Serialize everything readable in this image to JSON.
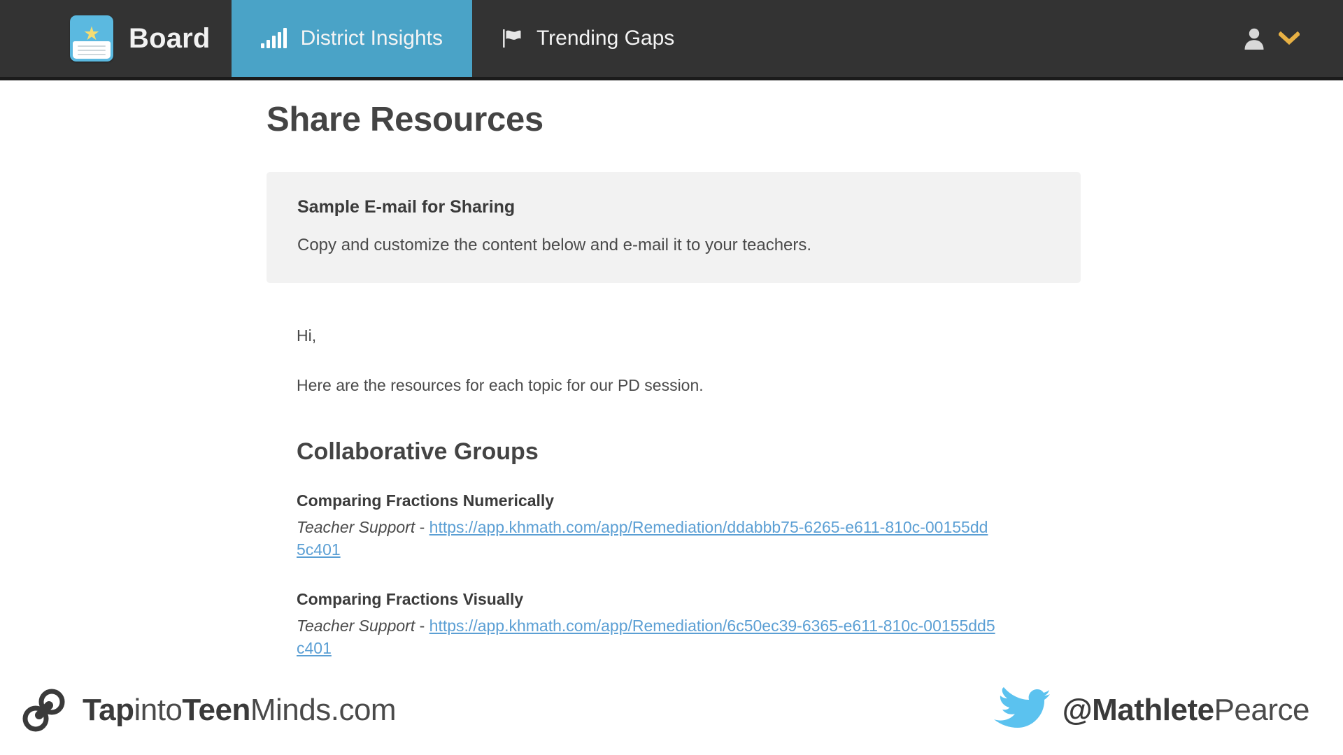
{
  "navbar": {
    "brand": {
      "label": "Board",
      "logo_icon": "book-star-icon",
      "star_glyph": "★"
    },
    "tabs": [
      {
        "label": "District Insights",
        "icon": "bar-chart-icon",
        "active": true
      },
      {
        "label": "Trending Gaps",
        "icon": "flag-icon",
        "active": false
      }
    ],
    "user_menu": {
      "avatar_icon": "user-icon",
      "chevron_icon": "chevron-down-icon"
    },
    "colors": {
      "background": "#333333",
      "active_tab": "#4aa3c7",
      "chevron": "#e8b144"
    }
  },
  "page": {
    "title": "Share Resources",
    "alert": {
      "title": "Sample E-mail for Sharing",
      "text": "Copy and customize the content below and e-mail it to your teachers.",
      "background": "#f2f2f2"
    },
    "email": {
      "greeting": "Hi,",
      "intro": "Here are the resources for each topic for our PD session.",
      "section_heading": "Collaborative Groups",
      "topics": [
        {
          "name": "Comparing Fractions Numerically",
          "label": "Teacher Support",
          "separator": " - ",
          "url": "https://app.khmath.com/app/Remediation/ddabbb75-6265-e611-810c-00155dd5c401"
        },
        {
          "name": "Comparing Fractions Visually",
          "label": "Teacher Support",
          "separator": " - ",
          "url": "https://app.khmath.com/app/Remediation/6c50ec39-6365-e611-810c-00155dd5c401"
        }
      ],
      "link_color": "#5b9fd4"
    }
  },
  "footer": {
    "site_icon": "chain-link-icon",
    "site_name_bold_1": "Tap",
    "site_name_light_1": "into",
    "site_name_bold_2": "Teen",
    "site_name_light_2": "Minds.com",
    "twitter_icon": "twitter-bird-icon",
    "handle_bold": "@Mathlete",
    "handle_light": "Pearce",
    "twitter_color": "#5bc2ef"
  }
}
